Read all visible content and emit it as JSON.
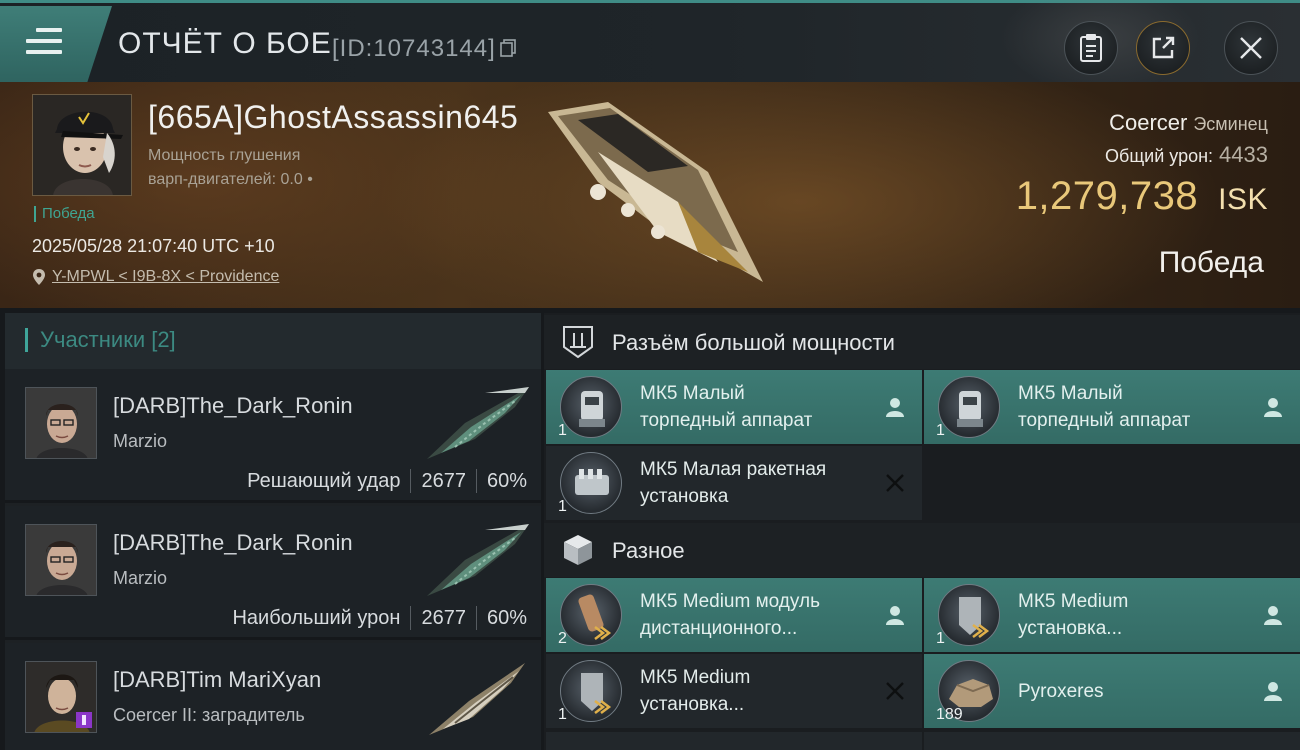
{
  "topbar": {
    "title": "ОТЧЁТ О БОЕ",
    "battle_id": "[ID:10743144]"
  },
  "pilot": {
    "name": "[665A]GhostAssassin645",
    "warp_line1": "Мощность глушения",
    "warp_line2": "варп-двигателей: 0.0",
    "result_tag": "Победа",
    "timestamp": "2025/05/28 21:07:40 UTC +10",
    "location": "Y-MPWL < I9B-8X < Providence"
  },
  "ship": {
    "name": "Coercer",
    "class": "Эсминец",
    "damage_label": "Общий урон:",
    "damage_value": "4433",
    "isk_value": "1,279,738",
    "isk_unit": "ISK",
    "outcome": "Победа"
  },
  "participants": {
    "header": "Участники [2]",
    "rows": [
      {
        "name": "[DARB]The_Dark_Ronin",
        "ship": "Marzio",
        "role": "Решающий удар",
        "damage": "2677",
        "percent": "60%"
      },
      {
        "name": "[DARB]The_Dark_Ronin",
        "ship": "Marzio",
        "role": "Наибольший урон",
        "damage": "2677",
        "percent": "60%"
      },
      {
        "name": "[DARB]Tim MariXyan",
        "ship": "Coercer II: заградитель"
      }
    ]
  },
  "fittings": {
    "high_power": {
      "title": "Разъём большой мощности",
      "slots": [
        {
          "line1": "МК5 Малый",
          "line2": "торпедный аппарат",
          "qty": "1",
          "status": "destroyed-owned"
        },
        {
          "line1": "МК5 Малый",
          "line2": "торпедный аппарат",
          "qty": "1",
          "status": "destroyed-owned"
        },
        {
          "line1": "МК5 Малая ракетная",
          "line2": "установка",
          "qty": "1",
          "status": "dropped"
        }
      ]
    },
    "misc": {
      "title": "Разное",
      "slots": [
        {
          "line1": "МК5 Medium модуль",
          "line2": "дистанционного...",
          "qty": "2",
          "status": "destroyed-owned"
        },
        {
          "line1": "МК5 Medium",
          "line2": "установка...",
          "qty": "1",
          "status": "destroyed-owned"
        },
        {
          "line1": "МК5 Medium",
          "line2": "установка...",
          "qty": "1",
          "status": "dropped"
        },
        {
          "line1": "Pyroxeres",
          "line2": "",
          "qty": "189",
          "status": "destroyed-owned"
        }
      ]
    }
  },
  "colors": {
    "accent_teal": "#3f8c86",
    "isk_gold": "#e9c87a",
    "victory_green": "#3fa592"
  }
}
